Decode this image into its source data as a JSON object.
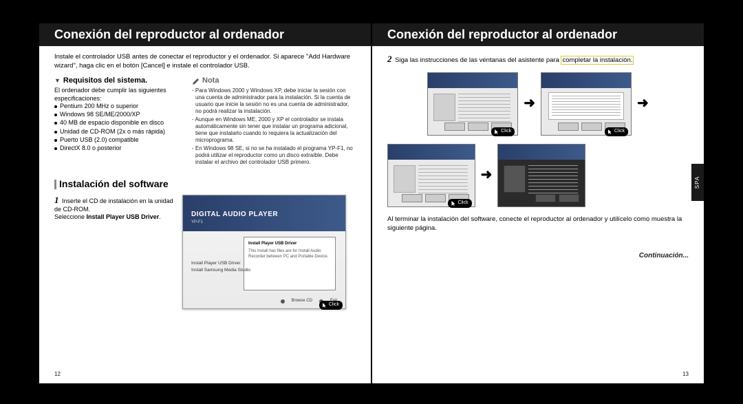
{
  "left": {
    "header": "Conexión del reproductor al ordenador",
    "intro": "Instale el controlador USB antes de conectar el reproductor y el ordenador. Si aparece \"Add Hardware wizard\", haga clic en el botón [Cancel] e instale el controlador USB.",
    "reqTitle": "Requisitos del sistema.",
    "reqSub": "El ordenador debe cumplir las siguientes especificaciones:",
    "reqs": [
      "Pentium 200 MHz o superior",
      "Windows 98 SE/ME/2000/XP",
      "40 MB de espacio disponible en disco",
      "Unidad de CD-ROM (2x o más rápida)",
      "Puerto USB (2.0) compatible",
      "DirectX 8.0 o posterior"
    ],
    "notaTitle": "Nota",
    "notas": [
      "Para Windows 2000 y Windows XP, debe iniciar la sesión con una cuenta de administrador para la instalación. Si la cuenta de usuario que inicie la sesión no es una cuenta de administrador, no podrá realizar la instalación.",
      "Aunque en Windows ME, 2000 y XP el controlador se instala automáticamente sin tener que instalar un programa adicional, tiene que instalarlo cuando lo requiera la actualización del microprograma.",
      "En Windows 98 SE, si no se ha instalado el programa YP-F1, no podrá utilizar el reproductor como un disco extraíble. Debe instalar el archivo del controlador USB primero."
    ],
    "secTitle": "Instalación del software",
    "step1a": "Inserte el CD de instalación en la unidad de CD-ROM.",
    "step1b": "Seleccione ",
    "step1bold": "Install Player USB Driver",
    "scrTitle": "DIGITAL AUDIO PLAYER",
    "scrSub": "YP-F1",
    "scrWinTitle": "Install Player USB Driver",
    "scrWinBody": "This Install has files are for Install Audio Recorder between PC and Portable Device.",
    "scrList1": "Install Player USB Driver",
    "scrList2": "Install Samsung Media Studio",
    "scrFoot1": "Browse CD",
    "scrFoot2": "Exit",
    "click": "Click",
    "page": "12"
  },
  "right": {
    "header": "Conexión del reproductor al ordenador",
    "step2a": "Siga las instrucciones de las ventanas del asistente para ",
    "step2hl": "completar la instalación.",
    "foot": "Al terminar la instalación del software, conecte el reproductor al ordenador y utilícelo como muestra la siguiente página.",
    "cont": "Continuación...",
    "click": "Click",
    "spa": "SPA",
    "page": "13"
  }
}
